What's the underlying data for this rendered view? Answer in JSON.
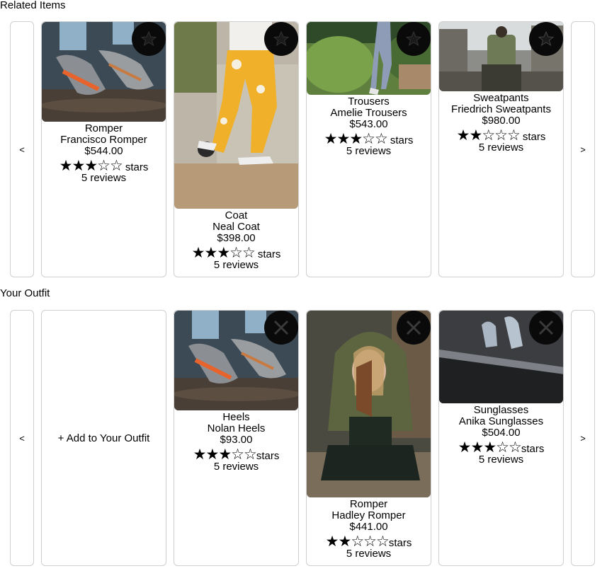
{
  "related": {
    "title": "Related Items",
    "prev_label": "<",
    "next_label": ">",
    "cards": [
      {
        "category": "Romper",
        "name": "Francisco Romper",
        "price": "$544.00",
        "stars": "★★★☆☆",
        "stars_label": "stars",
        "reviews": "5 reviews",
        "action_icon": "star-icon"
      },
      {
        "category": "Coat",
        "name": "Neal Coat",
        "price": "$398.00",
        "stars": "★★★☆☆",
        "stars_label": "stars",
        "reviews": "5 reviews",
        "action_icon": "star-icon"
      },
      {
        "category": "Trousers",
        "name": "Amelie Trousers",
        "price": "$543.00",
        "stars": "★★★☆☆",
        "stars_label": "stars",
        "reviews": "5 reviews",
        "action_icon": "star-icon"
      },
      {
        "category": "Sweatpants",
        "name": "Friedrich Sweatpants",
        "price": "$980.00",
        "stars": "★★☆☆☆",
        "stars_label": "stars",
        "reviews": "5 reviews",
        "action_icon": "star-icon"
      }
    ]
  },
  "outfit": {
    "title": "Your Outfit",
    "prev_label": "<",
    "next_label": ">",
    "add_label": "+ Add to Your Outfit",
    "cards": [
      {
        "category": "Heels",
        "name": "Nolan Heels",
        "price": "$93.00",
        "stars": "★★★☆☆",
        "stars_label": "stars",
        "reviews": "5 reviews",
        "action_icon": "close-icon"
      },
      {
        "category": "Romper",
        "name": "Hadley Romper",
        "price": "$441.00",
        "stars": "★★☆☆☆",
        "stars_label": "stars",
        "reviews": "5 reviews",
        "action_icon": "close-icon"
      },
      {
        "category": "Sunglasses",
        "name": "Anika Sunglasses",
        "price": "$504.00",
        "stars": "★★★☆☆",
        "stars_label": "stars",
        "reviews": "5 reviews",
        "action_icon": "close-icon"
      }
    ]
  }
}
